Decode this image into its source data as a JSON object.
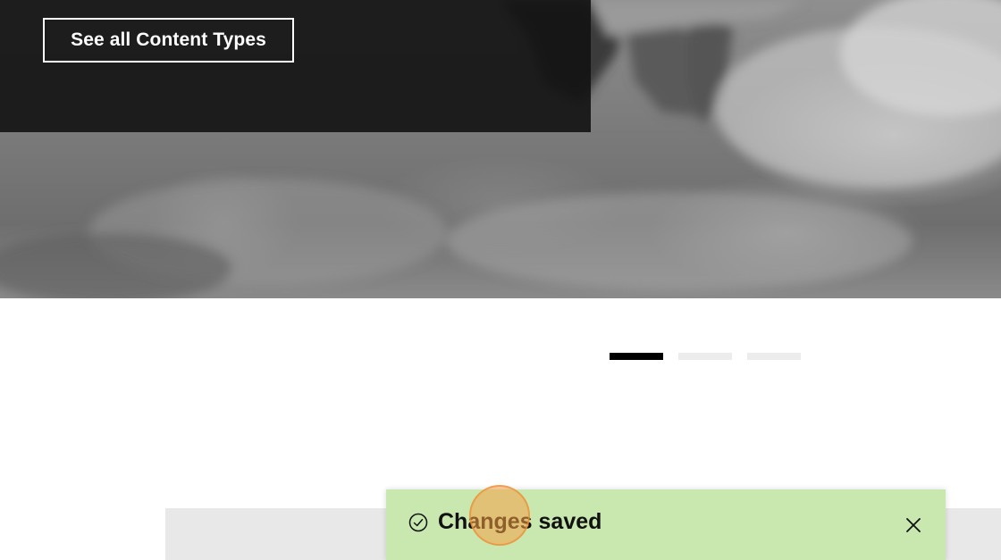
{
  "hero": {
    "cta_label": "See all Content Types"
  },
  "carousel": {
    "pages": 3,
    "active_index": 0
  },
  "toast": {
    "message": "Changes saved",
    "icon": "check-circle-icon",
    "close_icon": "close-icon",
    "background_color": "#c8e8b0"
  }
}
